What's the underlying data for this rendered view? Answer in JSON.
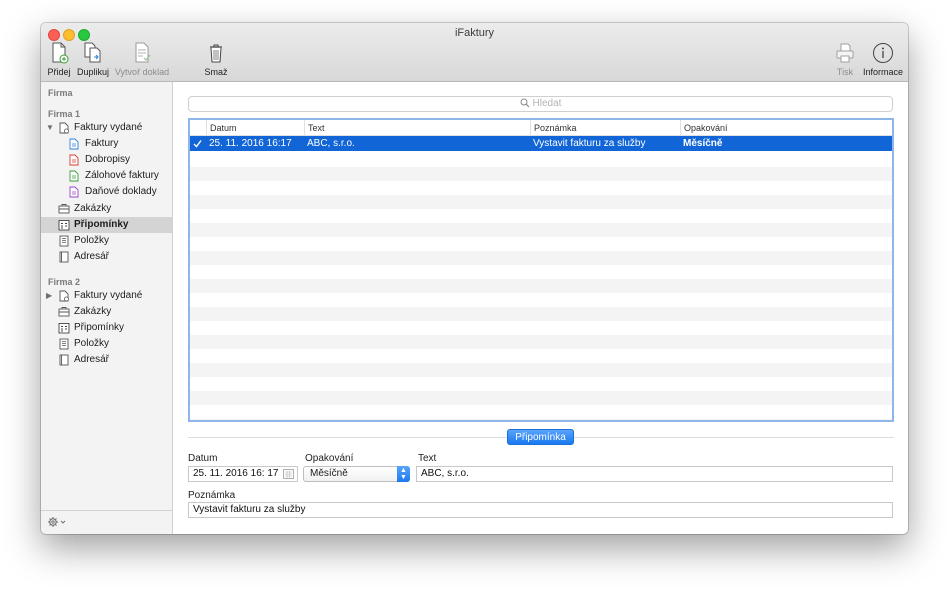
{
  "window": {
    "title": "iFaktury"
  },
  "toolbar": {
    "add_label": "Přidej",
    "duplicate_label": "Duplikuj",
    "create_doc_label": "Vytvoř doklad",
    "delete_label": "Smaž",
    "print_label": "Tisk",
    "info_label": "Informace"
  },
  "sidebar": {
    "header": "Firma",
    "group1": {
      "title": "Firma 1",
      "invoices": "Faktury vydané",
      "sub": [
        "Faktury",
        "Dobropisy",
        "Zálohové faktury",
        "Daňové doklady"
      ],
      "items": [
        "Zakázky",
        "Připomínky",
        "Položky",
        "Adresář"
      ]
    },
    "group2": {
      "title": "Firma 2",
      "invoices": "Faktury vydané",
      "items": [
        "Zakázky",
        "Připomínky",
        "Položky",
        "Adresář"
      ]
    }
  },
  "search": {
    "placeholder": "Hledat"
  },
  "table": {
    "columns": [
      "Datum",
      "Text",
      "Poznámka",
      "Opakování"
    ],
    "rows": [
      {
        "datum": "25. 11. 2016 16:17",
        "text": "ABC, s.r.o.",
        "poznamka": "Vystavit fakturu za služby",
        "opakovani": "Měsíčně"
      }
    ]
  },
  "detail": {
    "section_label": "Připomínka",
    "datum_label": "Datum",
    "datum_value": "25. 11. 2016 16: 17",
    "opakovani_label": "Opakování",
    "opakovani_value": "Měsíčně",
    "text_label": "Text",
    "text_value": "ABC, s.r.o.",
    "poznamka_label": "Poznámka",
    "poznamka_value": "Vystavit fakturu za služby"
  },
  "colors": {
    "accent": "#1165d6",
    "button_blue": "#1a79ef"
  }
}
